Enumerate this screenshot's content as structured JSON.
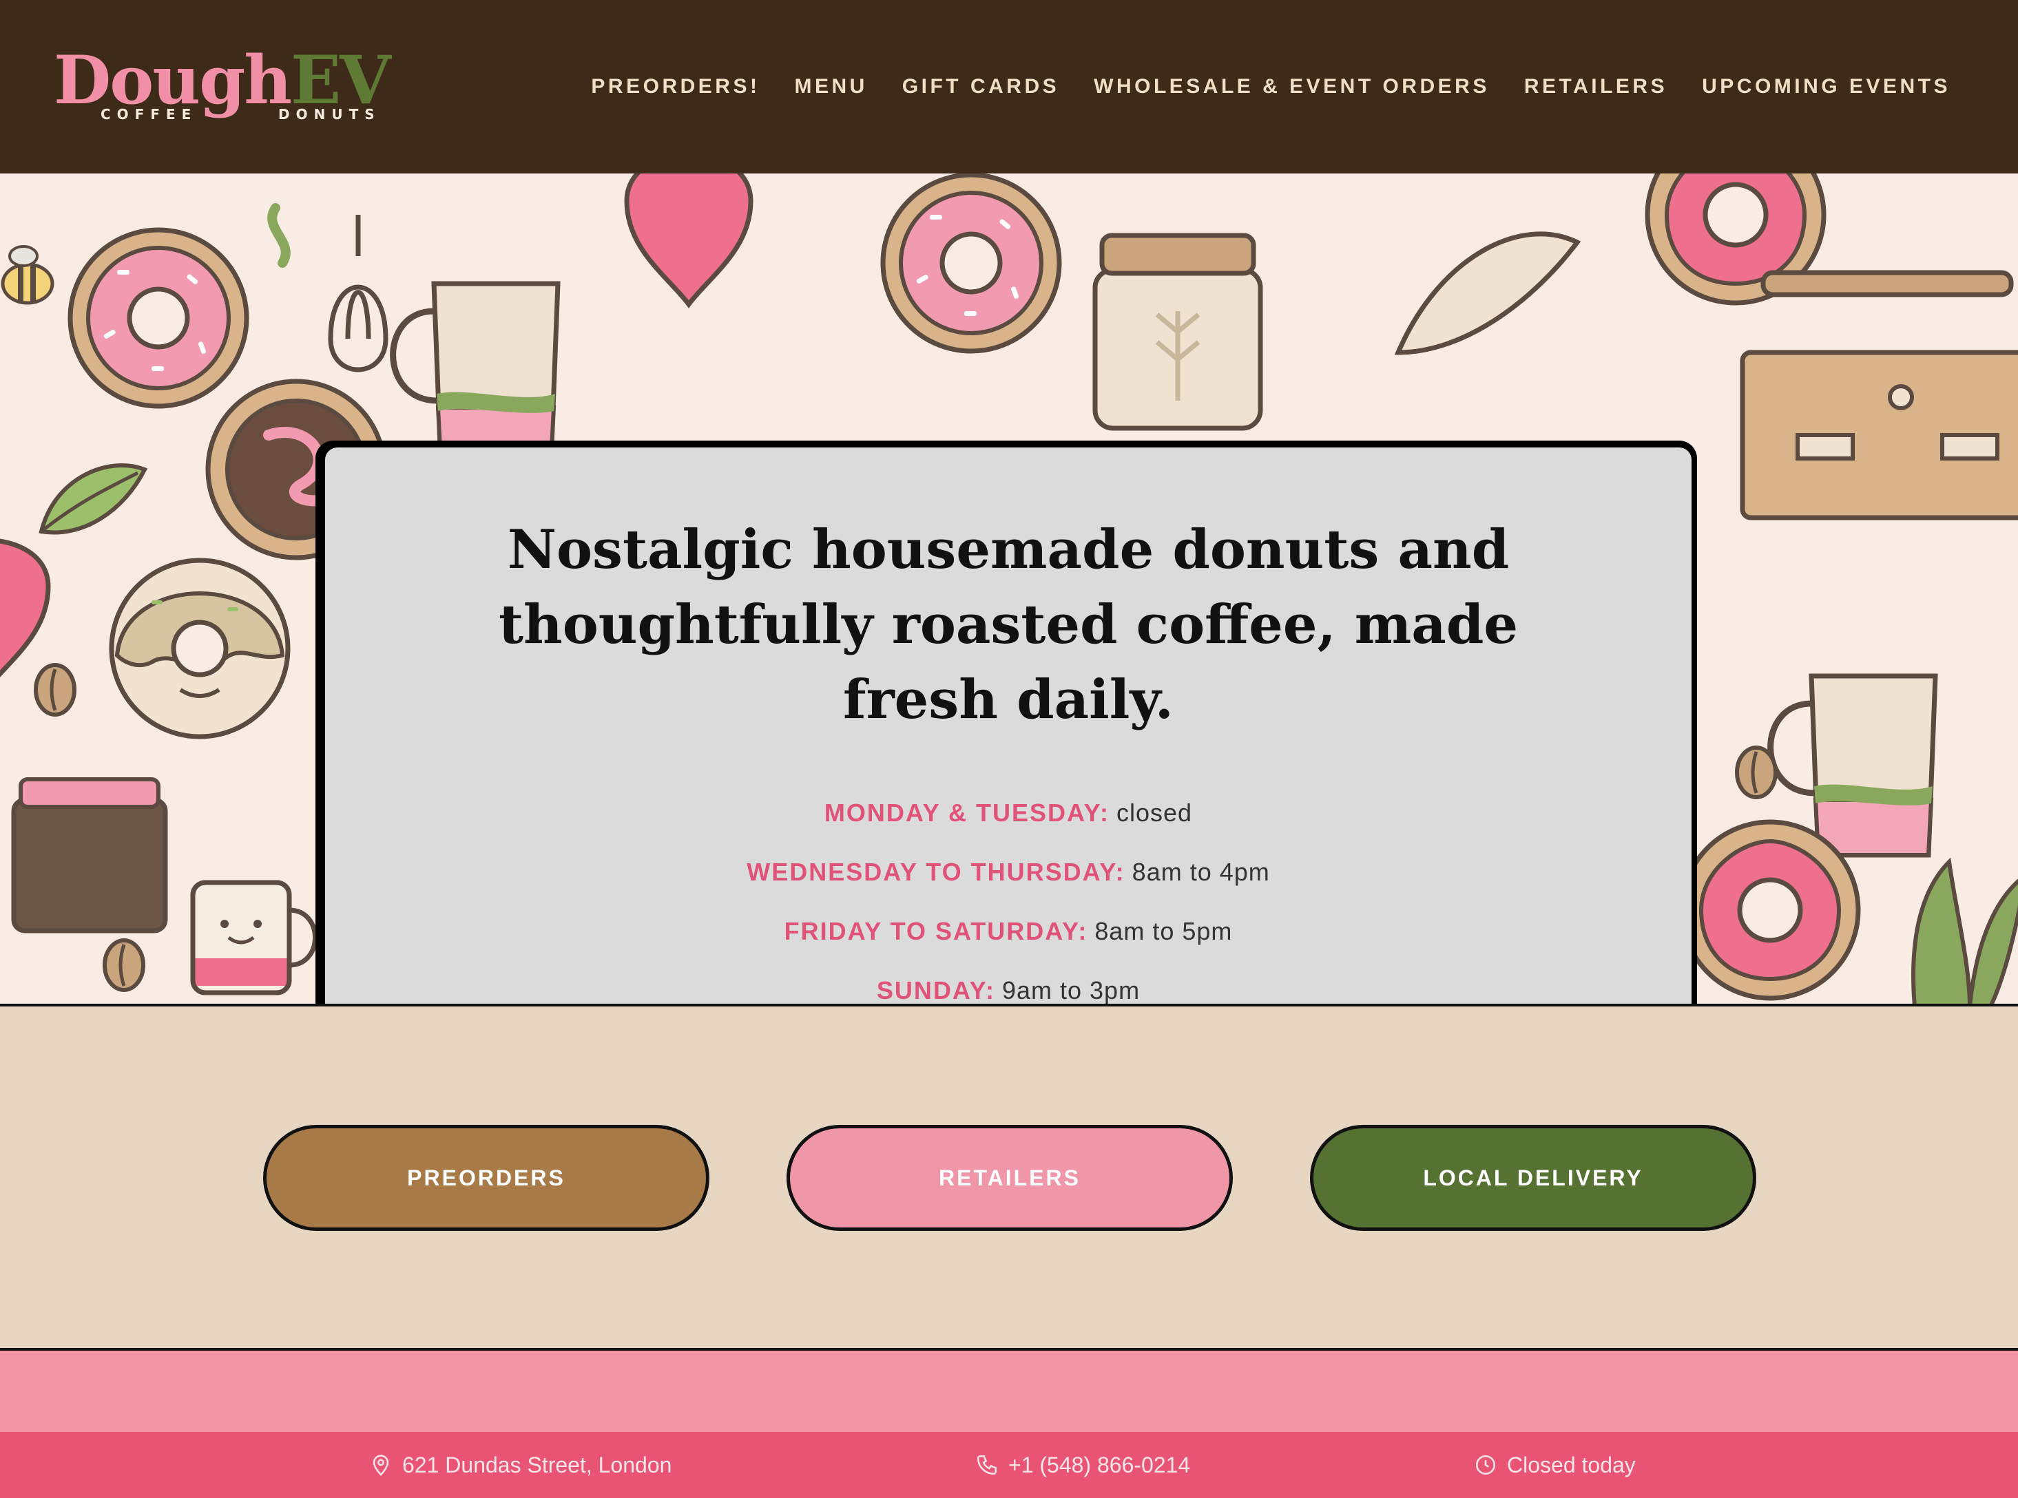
{
  "brand": {
    "logo_word_1": "Dough",
    "logo_word_2": "EV",
    "logo_sub_1": "COFFEE",
    "logo_sub_2": "DONUTS",
    "colors": {
      "pink": "#f08fa5",
      "green": "#5f7a35",
      "header": "#3d2a18"
    }
  },
  "nav": {
    "items": [
      {
        "label": "PREORDERS!"
      },
      {
        "label": "MENU"
      },
      {
        "label": "GIFT CARDS"
      },
      {
        "label": "WHOLESALE & EVENT ORDERS"
      },
      {
        "label": "RETAILERS"
      },
      {
        "label": "UPCOMING EVENTS"
      }
    ]
  },
  "hero": {
    "tagline_lines": [
      "Nostalgic housemade donuts and",
      "thoughtfully roasted coffee, made",
      "fresh daily."
    ],
    "hours": [
      {
        "day": "MONDAY & TUESDAY:",
        "time": "closed"
      },
      {
        "day": "WEDNESDAY TO THURSDAY:",
        "time": "8am to 4pm"
      },
      {
        "day": "FRIDAY TO SATURDAY:",
        "time": "8am to 5pm"
      },
      {
        "day": "SUNDAY:",
        "time": "9am to 3pm"
      }
    ],
    "background_icons": [
      "donut-icon",
      "coffee-jar-icon",
      "whisk-icon",
      "radish-icon",
      "espresso-machine-icon",
      "coffee-pot-icon",
      "mug-icon",
      "plant-icon",
      "bee-icon",
      "piping-bag-icon",
      "coffee-bean-icon",
      "rolling-pin-icon",
      "milk-jug-icon"
    ]
  },
  "cta": {
    "buttons": [
      {
        "label": "PREORDERS",
        "color": "#a87a47"
      },
      {
        "label": "RETAILERS",
        "color": "#f096a9"
      },
      {
        "label": "LOCAL DELIVERY",
        "color": "#567232"
      }
    ]
  },
  "footer": {
    "address": "621 Dundas Street, London",
    "phone": "+1 (548) 866-0214",
    "status": "Closed today",
    "icons": [
      "location-pin-icon",
      "phone-icon",
      "clock-icon"
    ]
  }
}
